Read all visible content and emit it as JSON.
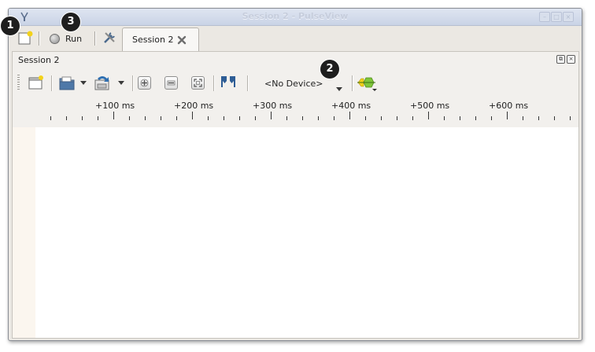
{
  "window": {
    "title": "Session 2 - PulseView"
  },
  "tabbar": {
    "run_label": "Run",
    "tab_label": "Session 2"
  },
  "panel": {
    "title": "Session 2"
  },
  "toolbar": {
    "device_label": "<No Device>"
  },
  "ruler": {
    "labels": [
      "+100 ms",
      "+200 ms",
      "+300 ms",
      "+400 ms",
      "+500 ms",
      "+600 ms"
    ]
  },
  "callouts": [
    "1",
    "2",
    "3"
  ],
  "icons": {
    "app": "pulseview-app-icon",
    "new_session": "new-session-icon",
    "run_indicator": "run-status-dot",
    "settings": "settings-tools-icon",
    "tab_close": "close-icon",
    "panel_restore": "restore-icon",
    "panel_close": "close-icon",
    "new_view": "new-view-icon",
    "open": "open-folder-icon",
    "save": "save-icon",
    "zoom_in": "zoom-in-icon",
    "zoom_out": "zoom-out-icon",
    "zoom_fit": "zoom-fit-icon",
    "cursors": "cursor-pair-icon",
    "decoders": "protocol-decoder-icon"
  },
  "colors": {
    "accent_green": "#7fc63a",
    "accent_yellow": "#f3d21a",
    "cursor_blue": "#2e5d95",
    "callout_bg": "#1e1e1e"
  }
}
